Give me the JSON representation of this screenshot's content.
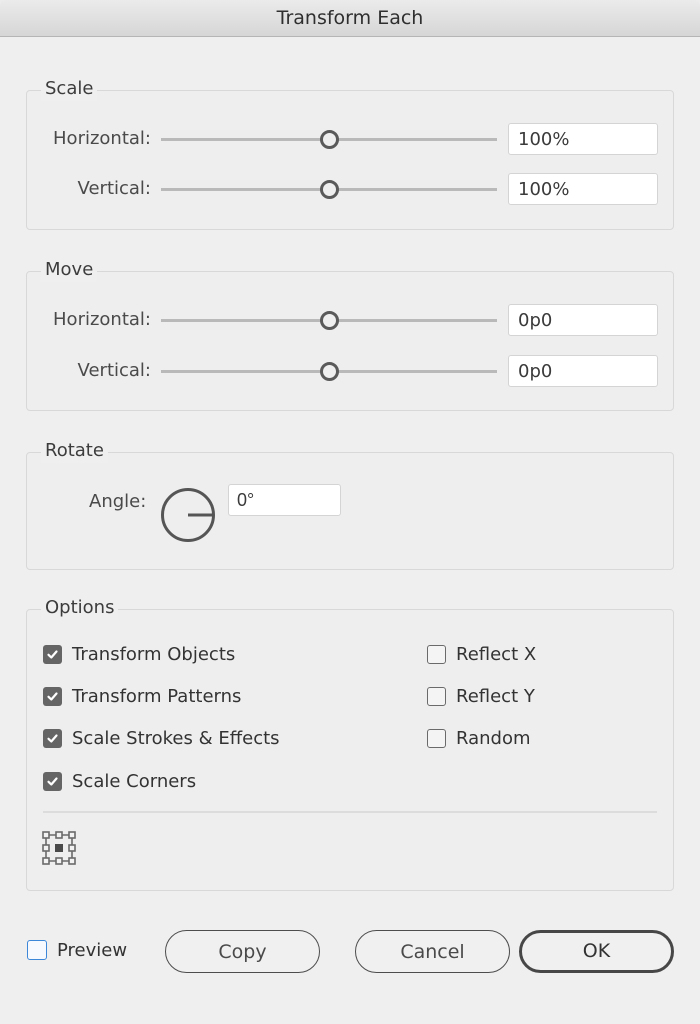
{
  "window": {
    "title": "Transform Each"
  },
  "scale": {
    "title": "Scale",
    "horizontal": {
      "label": "Horizontal:",
      "value": "100%",
      "slider_fraction": 0.5
    },
    "vertical": {
      "label": "Vertical:",
      "value": "100%",
      "slider_fraction": 0.5
    }
  },
  "move": {
    "title": "Move",
    "horizontal": {
      "label": "Horizontal:",
      "value": "0p0",
      "slider_fraction": 0.5
    },
    "vertical": {
      "label": "Vertical:",
      "value": "0p0",
      "slider_fraction": 0.5
    }
  },
  "rotate": {
    "title": "Rotate",
    "angle_label": "Angle:",
    "angle_value": "0°",
    "angle_degrees": 0
  },
  "options": {
    "title": "Options",
    "left": [
      {
        "label": "Transform Objects",
        "checked": true
      },
      {
        "label": "Transform Patterns",
        "checked": true
      },
      {
        "label": "Scale Strokes & Effects",
        "checked": true
      },
      {
        "label": "Scale Corners",
        "checked": true
      }
    ],
    "right": [
      {
        "label": "Reflect X",
        "checked": false
      },
      {
        "label": "Reflect Y",
        "checked": false
      },
      {
        "label": "Random",
        "checked": false
      }
    ],
    "reference_point": "center"
  },
  "footer": {
    "preview_label": "Preview",
    "preview_checked": false,
    "copy_label": "Copy",
    "cancel_label": "Cancel",
    "ok_label": "OK"
  },
  "colors": {
    "preview_accent": "#3d87d8",
    "checkbox_checked": "#656565"
  }
}
